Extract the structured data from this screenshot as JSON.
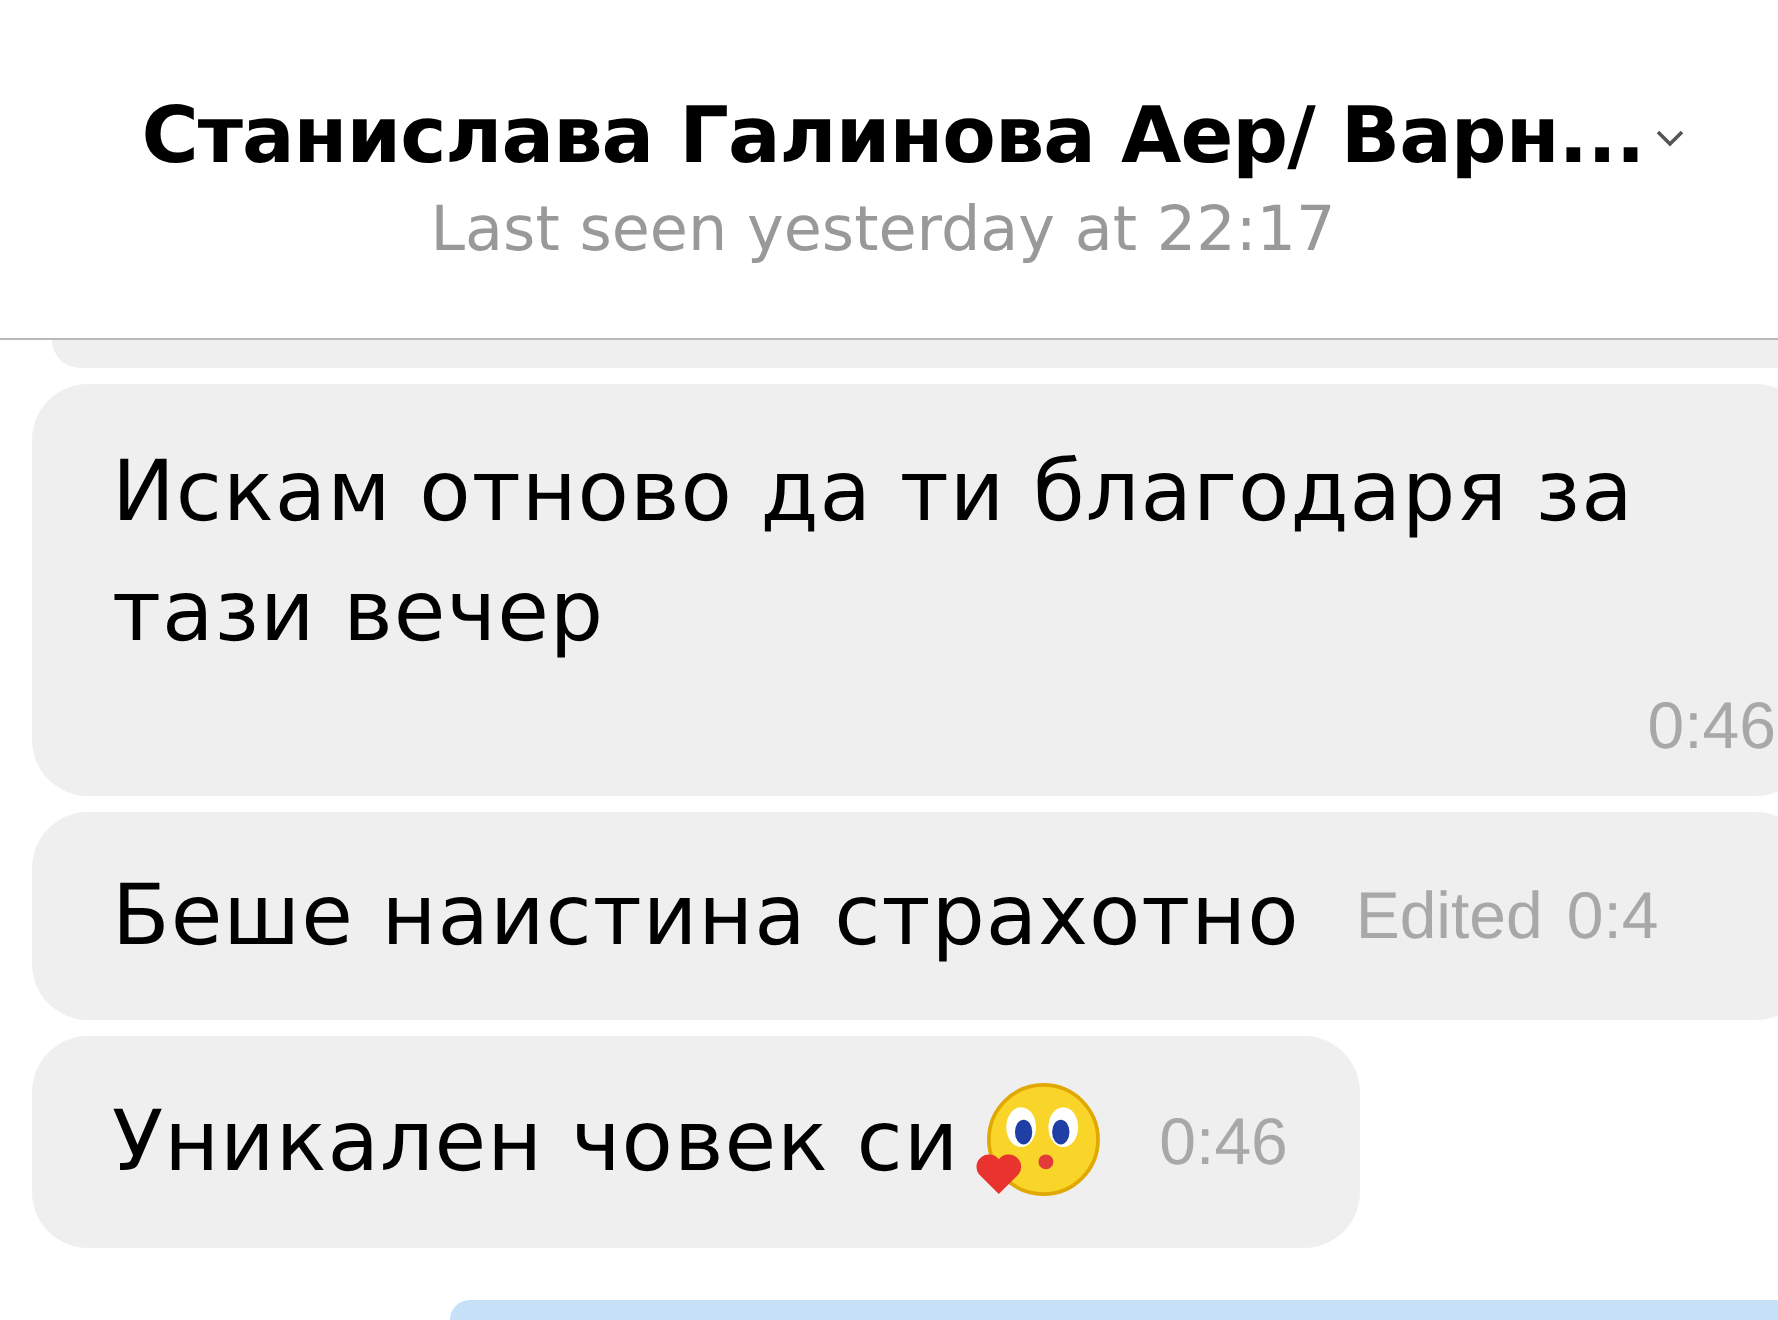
{
  "header": {
    "title": "Станислава Галинова Аер/ Варн...",
    "status": "Last seen yesterday at 22:17"
  },
  "messages": [
    {
      "kind": "cut",
      "outgoing": false
    },
    {
      "kind": "multiline",
      "outgoing": false,
      "text": "Искам отново да ти благодаря за тази вечер",
      "time": "0:46"
    },
    {
      "kind": "text",
      "outgoing": false,
      "text": "Беше наистина страхотно",
      "edited": "Edited",
      "time": "0:4"
    },
    {
      "kind": "text",
      "outgoing": false,
      "text": "Уникален човек си",
      "emoji": true,
      "time": "0:46"
    },
    {
      "kind": "cut",
      "outgoing": true
    }
  ]
}
